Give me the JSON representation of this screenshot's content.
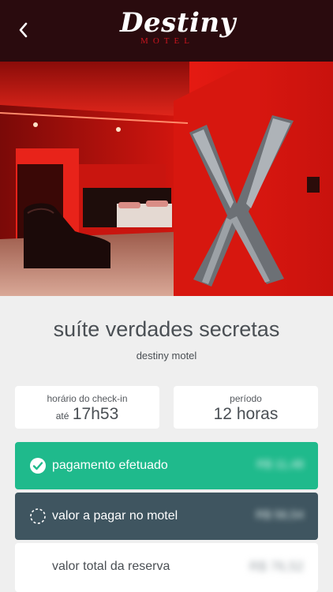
{
  "header": {
    "back_icon": "chevron-left-icon",
    "logo_main": "Destiny",
    "logo_sub": "MOTEL"
  },
  "suite": {
    "name": "suíte verdades secretas",
    "motel": "destiny motel"
  },
  "checkin": {
    "label": "horário do check-in",
    "prefix": "até",
    "time": "17h53"
  },
  "period": {
    "label": "período",
    "value": "12 horas"
  },
  "payment": {
    "paid_label": "pagamento efetuado",
    "paid_amount": "R$ 11,48",
    "due_label": "valor a pagar no motel",
    "due_amount": "R$ 56,54",
    "total_label": "valor total da reserva",
    "total_amount": "R$ 76,52"
  },
  "colors": {
    "header_bg": "#2a0b0e",
    "paid_bg": "#1fba8c",
    "due_bg": "#3f5560",
    "page_bg": "#efefef"
  }
}
